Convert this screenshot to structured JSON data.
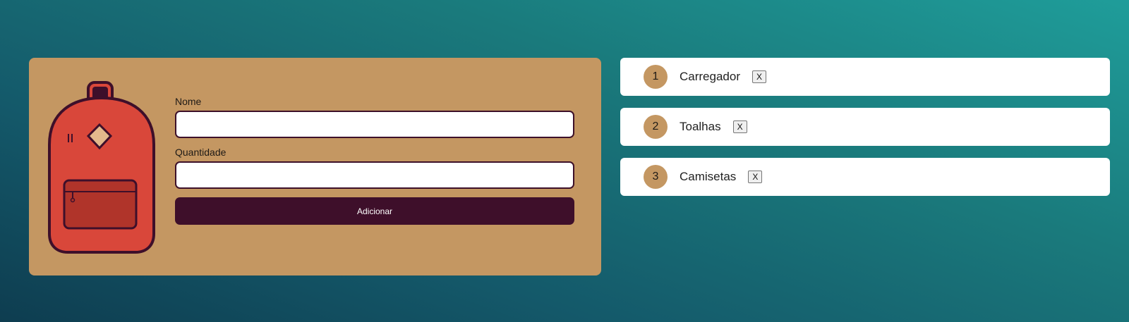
{
  "form": {
    "name_label": "Nome",
    "name_value": "",
    "quantity_label": "Quantidade",
    "quantity_value": "",
    "submit_label": "Adicionar"
  },
  "illustration": {
    "icon": "backpack-icon"
  },
  "items": [
    {
      "quantity": "1",
      "name": "Carregador",
      "remove_label": "X"
    },
    {
      "quantity": "2",
      "name": "Toalhas",
      "remove_label": "X"
    },
    {
      "quantity": "3",
      "name": "Camisetas",
      "remove_label": "X"
    }
  ],
  "colors": {
    "card": "#c49762",
    "accent_dark": "#3e0f2a",
    "backpack_red": "#d9473a",
    "background_light": "#1f9d9a",
    "background_dark": "#0e3d50"
  }
}
